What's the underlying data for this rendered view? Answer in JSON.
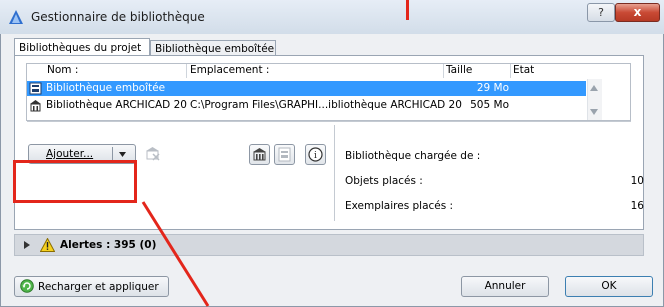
{
  "window": {
    "title": "Gestionnaire de bibliothèque",
    "help_label": "?",
    "close_label": "x"
  },
  "tabs": [
    {
      "label": "Bibliothèques du projet",
      "active": true
    },
    {
      "label": "Bibliothèque emboîtée",
      "active": false
    }
  ],
  "list": {
    "columns": [
      "Nom :",
      "Emplacement :",
      "Taille",
      "Etat"
    ],
    "rows": [
      {
        "name": "Bibliothèque emboîtée",
        "location": "",
        "size": "29 Mo",
        "state": "",
        "selected": true
      },
      {
        "name": "Bibliothèque ARCHICAD 20",
        "location": "C:\\Program Files\\GRAPHI...ibliothèque ARCHICAD 20",
        "size": "505 Mo",
        "state": "",
        "selected": false
      }
    ]
  },
  "toolbar": {
    "add_label": "Ajouter...",
    "info_label": "i"
  },
  "info": {
    "loaded_from_label": "Bibliothèque chargée de :",
    "placed_objects_label": "Objets placés :",
    "placed_objects_value": "10",
    "placed_instances_label": "Exemplaires placés :",
    "placed_instances_value": "16"
  },
  "alerts": {
    "label": "Alertes : 395 (0)"
  },
  "footer": {
    "reload_label": "Recharger et appliquer",
    "cancel_label": "Annuler",
    "ok_label": "OK"
  },
  "colors": {
    "selection": "#3399ff",
    "annotation_red": "#e3261b",
    "close_button": "#c94a35"
  }
}
